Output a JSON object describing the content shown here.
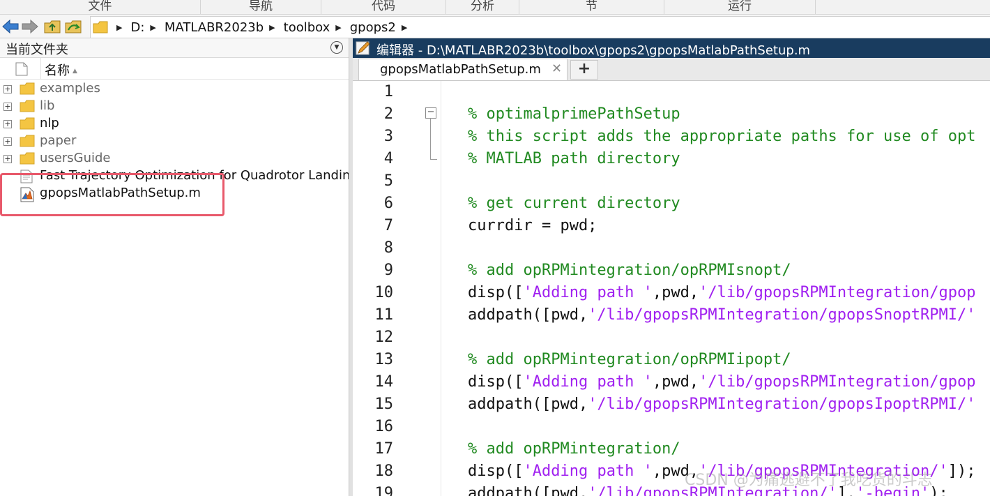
{
  "ribbon": {
    "sections": [
      "文件",
      "导航",
      "代码",
      "分析",
      "节",
      "运行"
    ]
  },
  "address": {
    "crumbs": [
      "D:",
      "MATLABR2023b",
      "toolbox",
      "gpops2"
    ]
  },
  "current_folder": {
    "title": "当前文件夹",
    "column_name": "名称",
    "items": [
      {
        "label": "examples",
        "type": "folder",
        "tone": "dim"
      },
      {
        "label": "lib",
        "type": "folder",
        "tone": "dim"
      },
      {
        "label": "nlp",
        "type": "folder",
        "tone": "dark"
      },
      {
        "label": "paper",
        "type": "folder",
        "tone": "dim"
      },
      {
        "label": "usersGuide",
        "type": "folder",
        "tone": "dim"
      },
      {
        "label": "Fast Trajectory Optimization for Quadrotor Landin...",
        "type": "file",
        "tone": "dark"
      },
      {
        "label": "gpopsMatlabPathSetup.m",
        "type": "mfile",
        "tone": "dark"
      }
    ]
  },
  "editor": {
    "title": "编辑器 - D:\\MATLABR2023b\\toolbox\\gpops2\\gpopsMatlabPathSetup.m",
    "tab_label": "gpopsMatlabPathSetup.m",
    "tab_close": "✕",
    "new_tab": "+",
    "fold_marker": "−",
    "lines": [
      {
        "n": "1",
        "parts": []
      },
      {
        "n": "2",
        "parts": [
          {
            "t": "% optimalprimePathSetup",
            "c": "cm"
          }
        ]
      },
      {
        "n": "3",
        "parts": [
          {
            "t": "% this script adds the appropriate paths for use of opt",
            "c": "cm"
          }
        ]
      },
      {
        "n": "4",
        "parts": [
          {
            "t": "% MATLAB path directory",
            "c": "cm"
          }
        ]
      },
      {
        "n": "5",
        "parts": []
      },
      {
        "n": "6",
        "parts": [
          {
            "t": "% get current directory",
            "c": "cm"
          }
        ]
      },
      {
        "n": "7",
        "parts": [
          {
            "t": "currdir = pwd;",
            "c": ""
          }
        ]
      },
      {
        "n": "8",
        "parts": []
      },
      {
        "n": "9",
        "parts": [
          {
            "t": "% add opRPMintegration/opRPMIsnopt/",
            "c": "cm"
          }
        ]
      },
      {
        "n": "10",
        "parts": [
          {
            "t": "disp([",
            "c": ""
          },
          {
            "t": "'Adding path '",
            "c": "st"
          },
          {
            "t": ",pwd,",
            "c": ""
          },
          {
            "t": "'/lib/gpopsRPMIntegration/gpop",
            "c": "st"
          }
        ]
      },
      {
        "n": "11",
        "parts": [
          {
            "t": "addpath([pwd,",
            "c": ""
          },
          {
            "t": "'/lib/gpopsRPMIntegration/gpopsSnoptRPMI/'",
            "c": "st"
          }
        ]
      },
      {
        "n": "12",
        "parts": []
      },
      {
        "n": "13",
        "parts": [
          {
            "t": "% add opRPMintegration/opRPMIipopt/",
            "c": "cm"
          }
        ]
      },
      {
        "n": "14",
        "parts": [
          {
            "t": "disp([",
            "c": ""
          },
          {
            "t": "'Adding path '",
            "c": "st"
          },
          {
            "t": ",pwd,",
            "c": ""
          },
          {
            "t": "'/lib/gpopsRPMIntegration/gpop",
            "c": "st"
          }
        ]
      },
      {
        "n": "15",
        "parts": [
          {
            "t": "addpath([pwd,",
            "c": ""
          },
          {
            "t": "'/lib/gpopsRPMIntegration/gpopsIpoptRPMI/'",
            "c": "st"
          }
        ]
      },
      {
        "n": "16",
        "parts": []
      },
      {
        "n": "17",
        "parts": [
          {
            "t": "% add opRPMintegration/",
            "c": "cm"
          }
        ]
      },
      {
        "n": "18",
        "parts": [
          {
            "t": "disp([",
            "c": ""
          },
          {
            "t": "'Adding path '",
            "c": "st"
          },
          {
            "t": ",pwd,",
            "c": ""
          },
          {
            "t": "'/lib/gpopsRPMIntegration/'",
            "c": "st"
          },
          {
            "t": "]);",
            "c": ""
          }
        ]
      },
      {
        "n": "19",
        "parts": [
          {
            "t": "addpath([pwd,",
            "c": ""
          },
          {
            "t": "'/lib/gpopsRPMIntegration/'",
            "c": "st"
          },
          {
            "t": "],",
            "c": ""
          },
          {
            "t": "'-begin'",
            "c": "st"
          },
          {
            "t": ");",
            "c": ""
          }
        ]
      }
    ]
  },
  "watermark": "CSDN @为痛逃避不了我吃货的斗志",
  "colors": {
    "editor_title_bg": "#193c5f",
    "comment": "#218a21",
    "string": "#a020f0",
    "highlight_box": "#e8596b"
  }
}
